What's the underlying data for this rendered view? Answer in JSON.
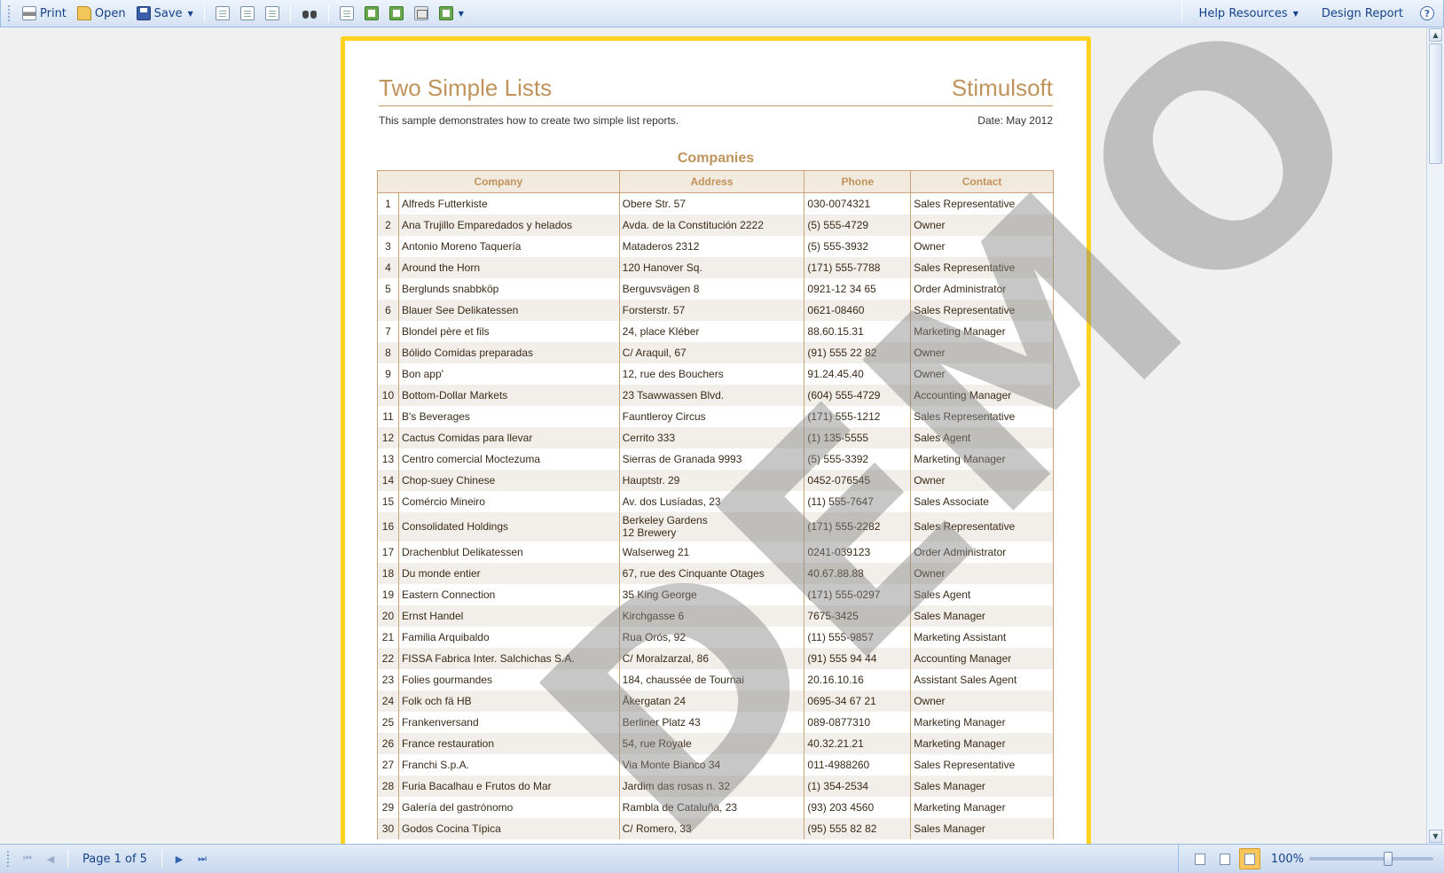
{
  "toolbar": {
    "print_label": "Print",
    "open_label": "Open",
    "save_label": "Save",
    "help_label": "Help Resources",
    "design_label": "Design Report",
    "help_icon_glyph": "?"
  },
  "report": {
    "title": "Two Simple Lists",
    "brand": "Stimulsoft",
    "description": "This sample demonstrates how to create two simple list reports.",
    "date": "Date: May 2012",
    "section_title": "Companies",
    "columns": [
      "Company",
      "Address",
      "Phone",
      "Contact"
    ],
    "watermark": "DEMO",
    "rows": [
      {
        "n": "1",
        "company": "Alfreds Futterkiste",
        "address": "Obere Str. 57",
        "phone": "030-0074321",
        "contact": "Sales Representative"
      },
      {
        "n": "2",
        "company": "Ana Trujillo Emparedados y helados",
        "address": "Avda. de la Constitución 2222",
        "phone": "(5) 555-4729",
        "contact": "Owner"
      },
      {
        "n": "3",
        "company": "Antonio Moreno Taquería",
        "address": "Mataderos  2312",
        "phone": "(5) 555-3932",
        "contact": "Owner"
      },
      {
        "n": "4",
        "company": "Around the Horn",
        "address": "120 Hanover Sq.",
        "phone": "(171) 555-7788",
        "contact": "Sales Representative"
      },
      {
        "n": "5",
        "company": "Berglunds snabbköp",
        "address": "Berguvsvägen  8",
        "phone": "0921-12 34 65",
        "contact": "Order Administrator"
      },
      {
        "n": "6",
        "company": "Blauer See Delikatessen",
        "address": "Forsterstr. 57",
        "phone": "0621-08460",
        "contact": "Sales Representative"
      },
      {
        "n": "7",
        "company": "Blondel père et fils",
        "address": "24, place Kléber",
        "phone": "88.60.15.31",
        "contact": "Marketing Manager"
      },
      {
        "n": "8",
        "company": "Bólido Comidas preparadas",
        "address": "C/ Araquil, 67",
        "phone": "(91) 555 22 82",
        "contact": "Owner"
      },
      {
        "n": "9",
        "company": "Bon app'",
        "address": "12, rue des Bouchers",
        "phone": "91.24.45.40",
        "contact": "Owner"
      },
      {
        "n": "10",
        "company": "Bottom-Dollar Markets",
        "address": "23 Tsawwassen Blvd.",
        "phone": "(604) 555-4729",
        "contact": "Accounting Manager"
      },
      {
        "n": "11",
        "company": "B's Beverages",
        "address": "Fauntleroy Circus",
        "phone": "(171) 555-1212",
        "contact": "Sales Representative"
      },
      {
        "n": "12",
        "company": "Cactus Comidas para llevar",
        "address": "Cerrito 333",
        "phone": "(1) 135-5555",
        "contact": "Sales Agent"
      },
      {
        "n": "13",
        "company": "Centro comercial Moctezuma",
        "address": "Sierras de Granada 9993",
        "phone": "(5) 555-3392",
        "contact": "Marketing Manager"
      },
      {
        "n": "14",
        "company": "Chop-suey Chinese",
        "address": "Hauptstr. 29",
        "phone": "0452-076545",
        "contact": "Owner"
      },
      {
        "n": "15",
        "company": "Comércio Mineiro",
        "address": "Av. dos Lusíadas, 23",
        "phone": "(11) 555-7647",
        "contact": "Sales Associate"
      },
      {
        "n": "16",
        "company": "Consolidated Holdings",
        "address": "Berkeley Gardens",
        "address2": "12  Brewery",
        "phone": "(171) 555-2282",
        "contact": "Sales Representative"
      },
      {
        "n": "17",
        "company": "Drachenblut Delikatessen",
        "address": "Walserweg 21",
        "phone": "0241-039123",
        "contact": "Order Administrator"
      },
      {
        "n": "18",
        "company": "Du monde entier",
        "address": "67, rue des Cinquante Otages",
        "phone": "40.67.88.88",
        "contact": "Owner"
      },
      {
        "n": "19",
        "company": "Eastern Connection",
        "address": "35 King George",
        "phone": "(171) 555-0297",
        "contact": "Sales Agent"
      },
      {
        "n": "20",
        "company": "Ernst Handel",
        "address": "Kirchgasse 6",
        "phone": "7675-3425",
        "contact": "Sales Manager"
      },
      {
        "n": "21",
        "company": "Familia Arquibaldo",
        "address": "Rua Orós, 92",
        "phone": "(11) 555-9857",
        "contact": "Marketing Assistant"
      },
      {
        "n": "22",
        "company": "FISSA Fabrica Inter. Salchichas S.A.",
        "address": "C/ Moralzarzal, 86",
        "phone": "(91) 555 94 44",
        "contact": "Accounting Manager"
      },
      {
        "n": "23",
        "company": "Folies gourmandes",
        "address": "184, chaussée de Tournai",
        "phone": "20.16.10.16",
        "contact": "Assistant Sales Agent"
      },
      {
        "n": "24",
        "company": "Folk och fä HB",
        "address": "Åkergatan 24",
        "phone": "0695-34 67 21",
        "contact": "Owner"
      },
      {
        "n": "25",
        "company": "Frankenversand",
        "address": "Berliner Platz 43",
        "phone": "089-0877310",
        "contact": "Marketing Manager"
      },
      {
        "n": "26",
        "company": "France restauration",
        "address": "54, rue Royale",
        "phone": "40.32.21.21",
        "contact": "Marketing Manager"
      },
      {
        "n": "27",
        "company": "Franchi S.p.A.",
        "address": "Via Monte Bianco 34",
        "phone": "011-4988260",
        "contact": "Sales Representative"
      },
      {
        "n": "28",
        "company": "Furia Bacalhau e Frutos do Mar",
        "address": "Jardim das rosas n. 32",
        "phone": "(1) 354-2534",
        "contact": "Sales Manager"
      },
      {
        "n": "29",
        "company": "Galería del gastrónomo",
        "address": "Rambla de Cataluña, 23",
        "phone": "(93) 203 4560",
        "contact": "Marketing Manager"
      },
      {
        "n": "30",
        "company": "Godos Cocina Típica",
        "address": "C/ Romero, 33",
        "phone": "(95) 555 82 82",
        "contact": "Sales Manager"
      }
    ]
  },
  "statusbar": {
    "page_info": "Page 1 of 5",
    "zoom": "100%",
    "zoom_fraction": 0.6
  },
  "colors": {
    "accent": "#c0935a",
    "page_border": "#ffd21e",
    "toolbar_text": "#15428b"
  }
}
